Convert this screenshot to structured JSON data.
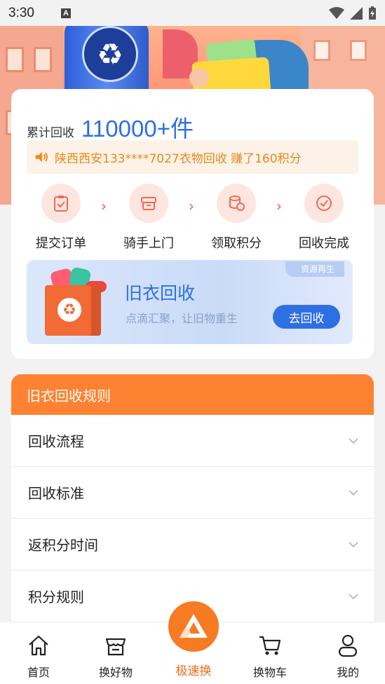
{
  "status_bar": {
    "time": "3:30",
    "notification_letter": "A"
  },
  "summary": {
    "label": "累计回收",
    "count": "110000+件"
  },
  "notice": {
    "text": "陕西西安133****7027衣物回收 赚了160积分"
  },
  "steps": [
    {
      "label": "提交订单",
      "icon": "clipboard-icon"
    },
    {
      "label": "骑手上门",
      "icon": "box-icon"
    },
    {
      "label": "领取积分",
      "icon": "coins-icon"
    },
    {
      "label": "回收完成",
      "icon": "check-circle-icon"
    }
  ],
  "banner": {
    "tag": "资源再生",
    "title": "旧衣回收",
    "subtitle": "点滴汇聚，让旧物重生",
    "button": "去回收"
  },
  "rules": {
    "title": "旧衣回收规则",
    "items": [
      "回收流程",
      "回收标准",
      "返积分时间",
      "积分规则"
    ]
  },
  "nav": {
    "home": "首页",
    "exchange": "换好物",
    "quick": "极速换",
    "cart": "换物车",
    "mine": "我的"
  },
  "colors": {
    "accent_orange": "#ff8232",
    "accent_blue": "#2c6fe0",
    "notice_text": "#e88a1a"
  }
}
